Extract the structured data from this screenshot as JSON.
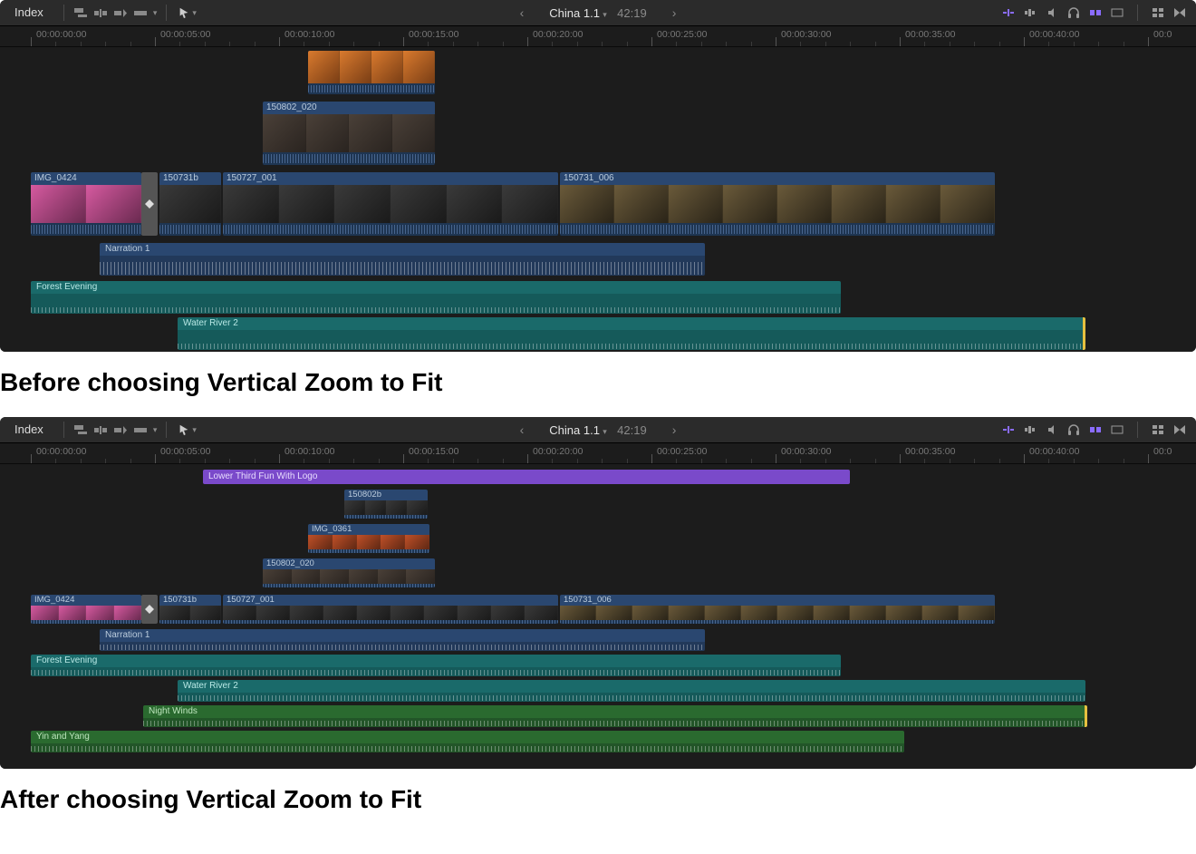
{
  "toolbar": {
    "index_label": "Index",
    "project_name": "China 1.1",
    "timecode": "42:19"
  },
  "ruler_ticks": [
    "00:00:00:00",
    "00:00:05:00",
    "00:00:10:00",
    "00:00:15:00",
    "00:00:20:00",
    "00:00:25:00",
    "00:00:30:00",
    "00:00:35:00",
    "00:00:40:00"
  ],
  "panel1": {
    "clips": {
      "upper1_label": "150802_020",
      "primary": [
        {
          "label": "IMG_0424"
        },
        {
          "label": "150731b"
        },
        {
          "label": "150727_001"
        },
        {
          "label": "150731_006"
        }
      ],
      "audio1": "Narration 1",
      "audio2": "Forest Evening",
      "audio3": "Water River 2"
    }
  },
  "caption1": "Before choosing Vertical Zoom to Fit",
  "panel2": {
    "title_clip": "Lower Third Fun With Logo",
    "upper": [
      {
        "label": "150802b"
      },
      {
        "label": "IMG_0361"
      },
      {
        "label": "150802_020"
      }
    ],
    "primary": [
      {
        "label": "IMG_0424"
      },
      {
        "label": "150731b"
      },
      {
        "label": "150727_001"
      },
      {
        "label": "150731_006"
      }
    ],
    "audio": [
      "Narration 1",
      "Forest Evening",
      "Water River 2",
      "Night Winds",
      "Yin and Yang"
    ]
  },
  "caption2": "After choosing Vertical Zoom to Fit"
}
